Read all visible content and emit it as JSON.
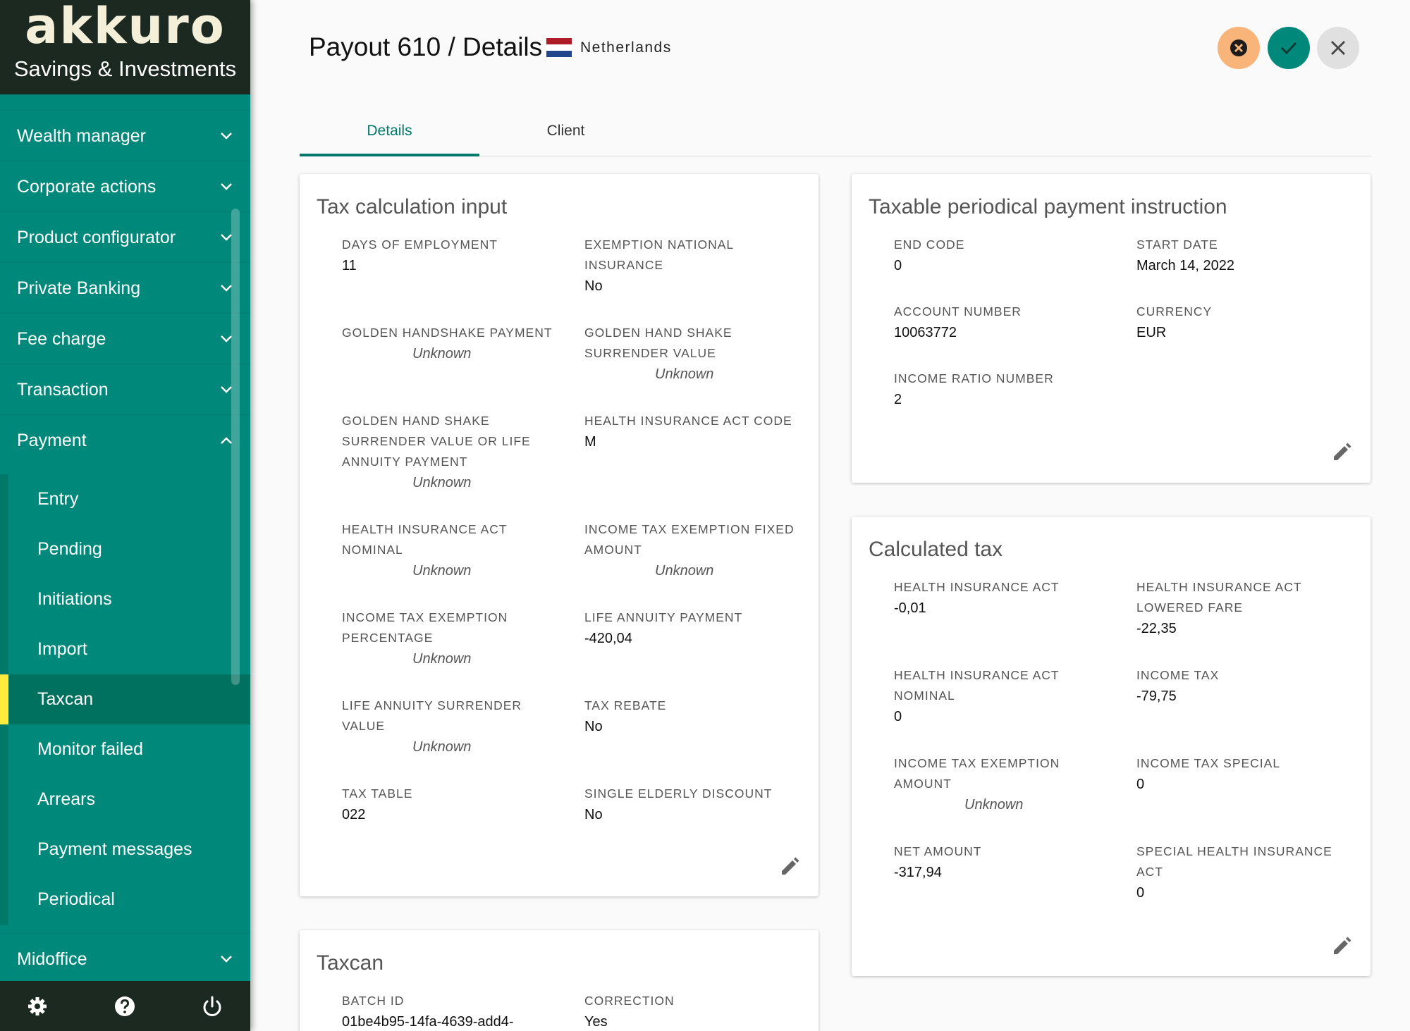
{
  "brand": {
    "logo": "akkuro",
    "subtitle": "Savings & Investments"
  },
  "nav": {
    "items": [
      {
        "label": "Wealth manager"
      },
      {
        "label": "Corporate actions"
      },
      {
        "label": "Product configurator"
      },
      {
        "label": "Private Banking"
      },
      {
        "label": "Fee charge"
      },
      {
        "label": "Transaction"
      },
      {
        "label": "Payment"
      }
    ],
    "payment_sub": [
      {
        "label": "Entry"
      },
      {
        "label": "Pending"
      },
      {
        "label": "Initiations"
      },
      {
        "label": "Import"
      },
      {
        "label": "Taxcan"
      },
      {
        "label": "Monitor failed"
      },
      {
        "label": "Arrears"
      },
      {
        "label": "Payment messages"
      },
      {
        "label": "Periodical"
      }
    ],
    "midoffice": "Midoffice",
    "active_sub": "Taxcan"
  },
  "header": {
    "title": "Payout 610 / Details",
    "country": "Netherlands"
  },
  "tabs": [
    {
      "label": "Details"
    },
    {
      "label": "Client"
    }
  ],
  "tax_input": {
    "title": "Tax calculation input",
    "fields": [
      {
        "label": "DAYS OF EMPLOYMENT",
        "value": "11"
      },
      {
        "label": "EXEMPTION NATIONAL INSURANCE",
        "value": "No"
      },
      {
        "label": "GOLDEN HANDSHAKE PAYMENT",
        "value": "Unknown"
      },
      {
        "label": "GOLDEN HAND SHAKE SURRENDER VALUE",
        "value": "Unknown"
      },
      {
        "label": "GOLDEN HAND SHAKE SURRENDER VALUE OR LIFE ANNUITY PAYMENT",
        "value": "Unknown"
      },
      {
        "label": "HEALTH INSURANCE ACT CODE",
        "value": "M"
      },
      {
        "label": "HEALTH INSURANCE ACT NOMINAL",
        "value": "Unknown"
      },
      {
        "label": "INCOME TAX EXEMPTION FIXED AMOUNT",
        "value": "Unknown"
      },
      {
        "label": "INCOME TAX EXEMPTION PERCENTAGE",
        "value": "Unknown"
      },
      {
        "label": "LIFE ANNUITY PAYMENT",
        "value": "-420,04"
      },
      {
        "label": "LIFE ANNUITY SURRENDER VALUE",
        "value": "Unknown"
      },
      {
        "label": "TAX REBATE",
        "value": "No"
      },
      {
        "label": "TAX TABLE",
        "value": "022"
      },
      {
        "label": "SINGLE ELDERLY DISCOUNT",
        "value": "No"
      }
    ]
  },
  "periodical": {
    "title": "Taxable periodical payment instruction",
    "fields": [
      {
        "label": "END CODE",
        "value": "0"
      },
      {
        "label": "START DATE",
        "value": "March 14, 2022"
      },
      {
        "label": "ACCOUNT NUMBER",
        "value": "10063772"
      },
      {
        "label": "CURRENCY",
        "value": "EUR"
      },
      {
        "label": "INCOME RATIO NUMBER",
        "value": "2"
      }
    ]
  },
  "calculated": {
    "title": "Calculated tax",
    "fields": [
      {
        "label": "HEALTH INSURANCE ACT",
        "value": "-0,01"
      },
      {
        "label": "HEALTH INSURANCE ACT LOWERED FARE",
        "value": "-22,35"
      },
      {
        "label": "HEALTH INSURANCE ACT NOMINAL",
        "value": "0"
      },
      {
        "label": "INCOME TAX",
        "value": "-79,75"
      },
      {
        "label": "INCOME TAX EXEMPTION AMOUNT",
        "value": "Unknown"
      },
      {
        "label": "INCOME TAX SPECIAL",
        "value": "0"
      },
      {
        "label": "NET AMOUNT",
        "value": "-317,94"
      },
      {
        "label": "SPECIAL HEALTH INSURANCE ACT",
        "value": "0"
      }
    ]
  },
  "taxcan": {
    "title": "Taxcan",
    "fields": [
      {
        "label": "BATCH ID",
        "value": "01be4b95-14fa-4639-add4-"
      },
      {
        "label": "CORRECTION",
        "value": "Yes"
      }
    ]
  },
  "colors": {
    "sidebar": "#00897b",
    "brand_bg": "#1b2921",
    "accent": "#00796b",
    "active_marker": "#ffeb3b",
    "cancel_button": "#f9b47a",
    "confirm_button": "#00897b"
  },
  "icons": {
    "settings": "gear-icon",
    "help": "help-icon",
    "power": "power-icon",
    "edit": "pencil-icon"
  }
}
